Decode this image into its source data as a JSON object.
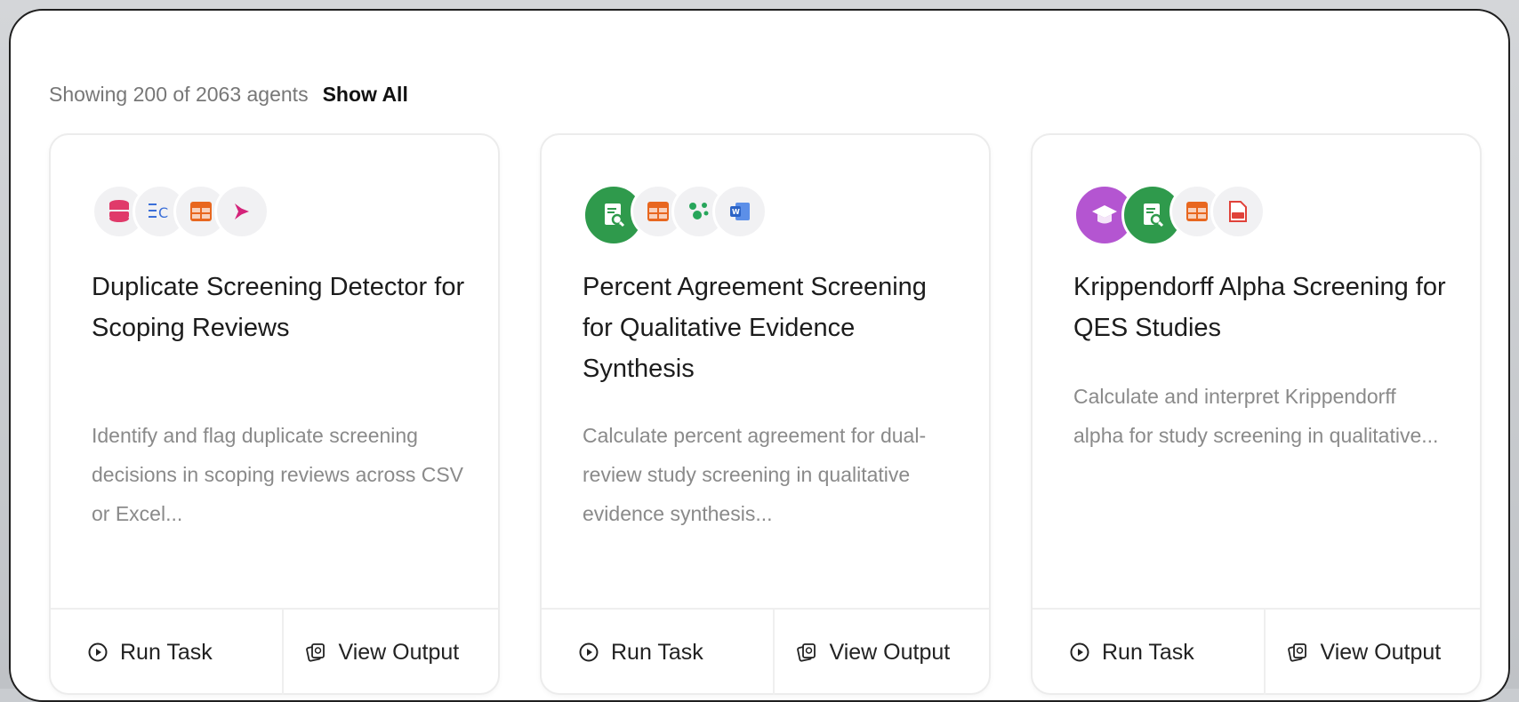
{
  "summary": {
    "text": "Showing 200 of 2063 agents",
    "show_all_label": "Show All"
  },
  "cards": [
    {
      "title": "Duplicate Screening Detector for Scoping Reviews",
      "description": "Identify and flag duplicate screening decisions in scoping reviews across CSV or Excel...",
      "icons": [
        "database-icon",
        "column-list-icon",
        "spreadsheet-icon",
        "pipeline-arrow-icon"
      ],
      "run_label": "Run Task",
      "view_label": "View Output"
    },
    {
      "title": "Percent Agreement Screening for Qualitative Evidence Synthesis",
      "description": "Calculate percent agreement for dual-review study screening in qualitative evidence synthesis...",
      "icons": [
        "document-search-icon",
        "spreadsheet-icon",
        "cluster-icon",
        "word-doc-icon"
      ],
      "run_label": "Run Task",
      "view_label": "View Output"
    },
    {
      "title": "Krippendorff Alpha Screening for QES Studies",
      "description": "Calculate and interpret Krippendorff alpha for study screening in qualitative...",
      "icons": [
        "graduation-cap-icon",
        "document-search-icon",
        "spreadsheet-icon",
        "pdf-icon"
      ],
      "run_label": "Run Task",
      "view_label": "View Output"
    }
  ],
  "colors": {
    "database": "#e03a6a",
    "columns": "#3b6fd8",
    "spreadsheet": "#e8671f",
    "pipeline": "#d4237a",
    "doc_search_bg": "#2f9a4c",
    "cluster": "#27a55a",
    "word": "#2b63c6",
    "cap_bg": "#b455d1",
    "pdf": "#e0423a"
  }
}
